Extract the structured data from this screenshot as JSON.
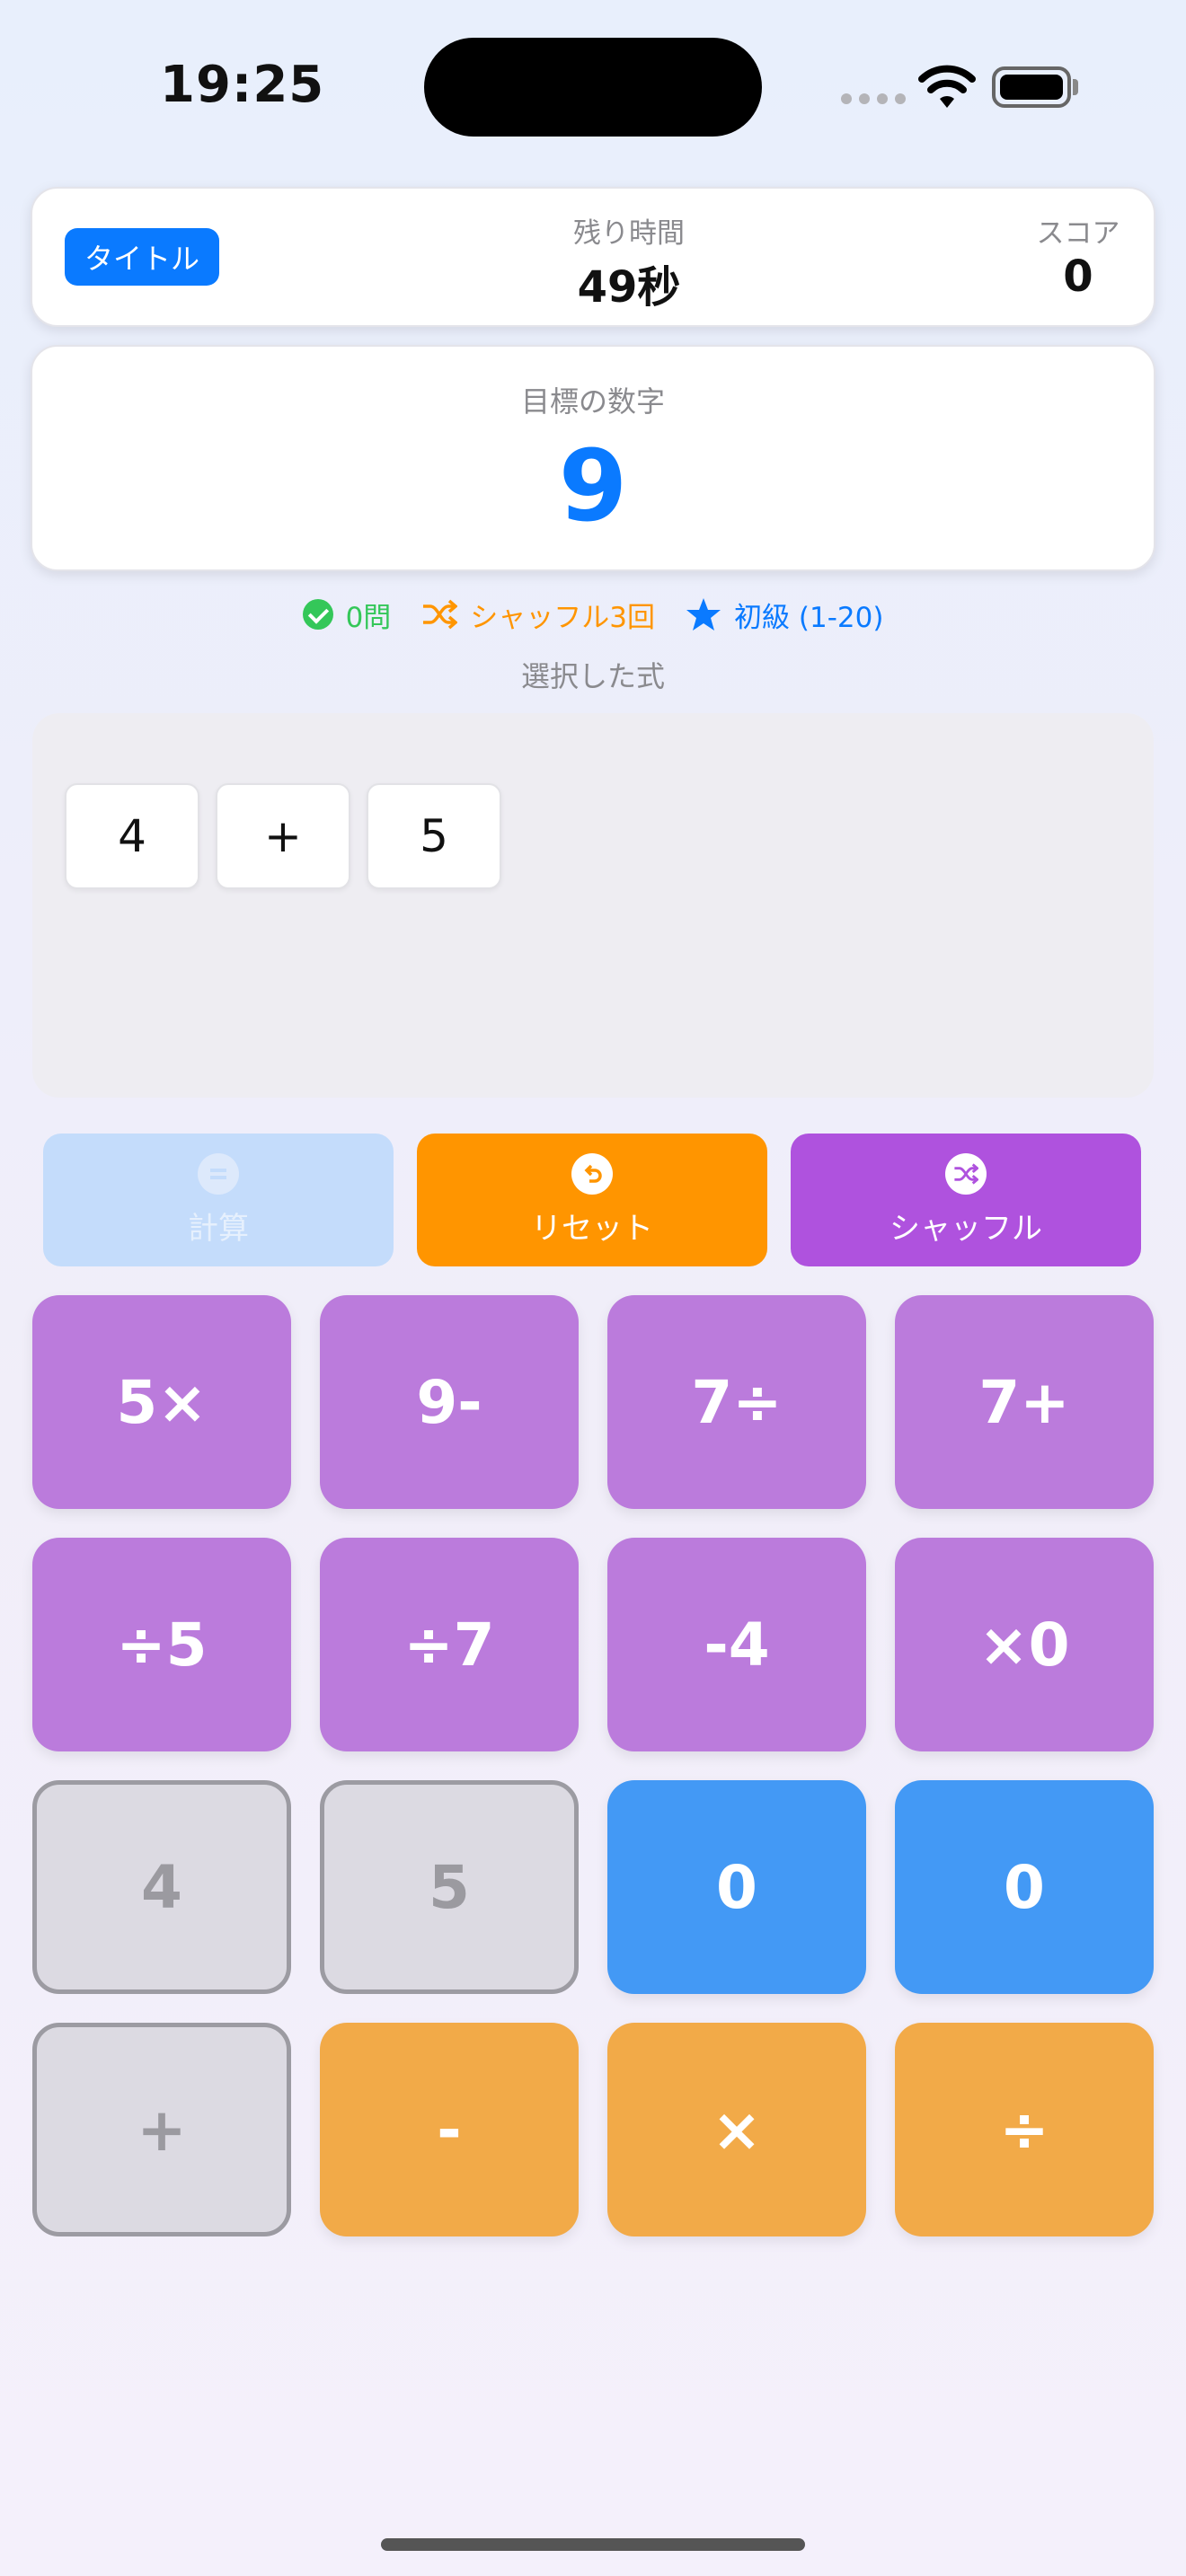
{
  "status_bar": {
    "time": "19:25"
  },
  "header": {
    "title_button": "タイトル",
    "time_label": "残り時間",
    "time_value": "49秒",
    "score_label": "スコア",
    "score_value": "0"
  },
  "target": {
    "label": "目標の数字",
    "value": "9"
  },
  "stats": {
    "solved": "0問",
    "shuffles": "シャッフル3回",
    "level": "初級 (1-20)"
  },
  "expression": {
    "label": "選択した式",
    "tokens": [
      "4",
      "+",
      "5"
    ]
  },
  "actions": {
    "calculate": "計算",
    "reset": "リセット",
    "shuffle": "シャッフル"
  },
  "keypad": [
    [
      "5×",
      "9-",
      "7÷",
      "7+"
    ],
    [
      "÷5",
      "÷7",
      "-4",
      "×0"
    ],
    [
      "4",
      "5",
      "0",
      "0"
    ],
    [
      "+",
      "-",
      "×",
      "÷"
    ]
  ],
  "colors": {
    "accent_blue": "#0a7aff",
    "orange": "#ff9500",
    "purple": "#af52de",
    "green": "#34c759"
  }
}
